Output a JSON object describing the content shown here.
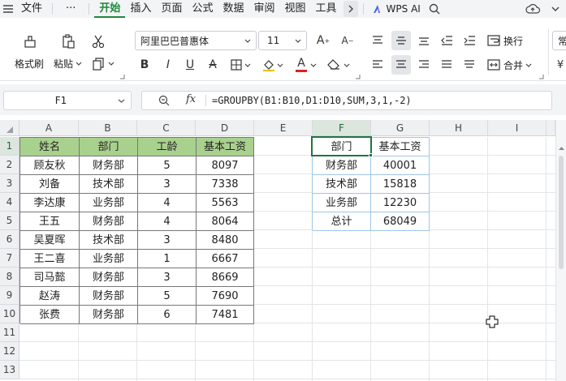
{
  "menubar": {
    "file": "文件",
    "more": "···",
    "tabs": [
      "开始",
      "插入",
      "页面",
      "公式",
      "数据",
      "审阅",
      "视图",
      "工具"
    ],
    "wps_ai": "WPS AI"
  },
  "ribbon": {
    "format_painter": "格式刷",
    "paste": "粘贴",
    "font_name": "阿里巴巴普惠体",
    "font_size": "11",
    "bold": "B",
    "italic": "I",
    "underline": "U",
    "strike": "A",
    "font_color": "A",
    "wrap": "换行",
    "merge": "合并",
    "number_format": "常"
  },
  "formula_bar": {
    "cell_ref": "F1",
    "fx": "fx",
    "formula": "=GROUPBY(B1:B10,D1:D10,SUM,3,1,-2)"
  },
  "columns": [
    "A",
    "B",
    "C",
    "D",
    "E",
    "F",
    "G",
    "H",
    "I"
  ],
  "rows": [
    "1",
    "2",
    "3",
    "4",
    "5",
    "6",
    "7",
    "8",
    "9",
    "10",
    "11",
    "12",
    "13"
  ],
  "table": {
    "headers": [
      "姓名",
      "部门",
      "工龄",
      "基本工资"
    ],
    "rows": [
      [
        "顾友秋",
        "财务部",
        "5",
        "8097"
      ],
      [
        "刘备",
        "技术部",
        "3",
        "7338"
      ],
      [
        "李达康",
        "业务部",
        "4",
        "5563"
      ],
      [
        "王五",
        "财务部",
        "4",
        "8064"
      ],
      [
        "吴夏晖",
        "技术部",
        "3",
        "8480"
      ],
      [
        "王二喜",
        "业务部",
        "1",
        "6667"
      ],
      [
        "司马懿",
        "财务部",
        "3",
        "8669"
      ],
      [
        "赵涛",
        "财务部",
        "5",
        "7690"
      ],
      [
        "张费",
        "财务部",
        "6",
        "7481"
      ]
    ]
  },
  "result": {
    "headers": [
      "部门",
      "基本工资"
    ],
    "rows": [
      [
        "财务部",
        "40001"
      ],
      [
        "技术部",
        "15818"
      ],
      [
        "业务部",
        "12230"
      ],
      [
        "总计",
        "68049"
      ]
    ]
  },
  "colors": {
    "accent": "#1c8b3c",
    "header_fill": "#a9d18e",
    "selection": "#217346",
    "result_border": "#9fc5e8"
  }
}
